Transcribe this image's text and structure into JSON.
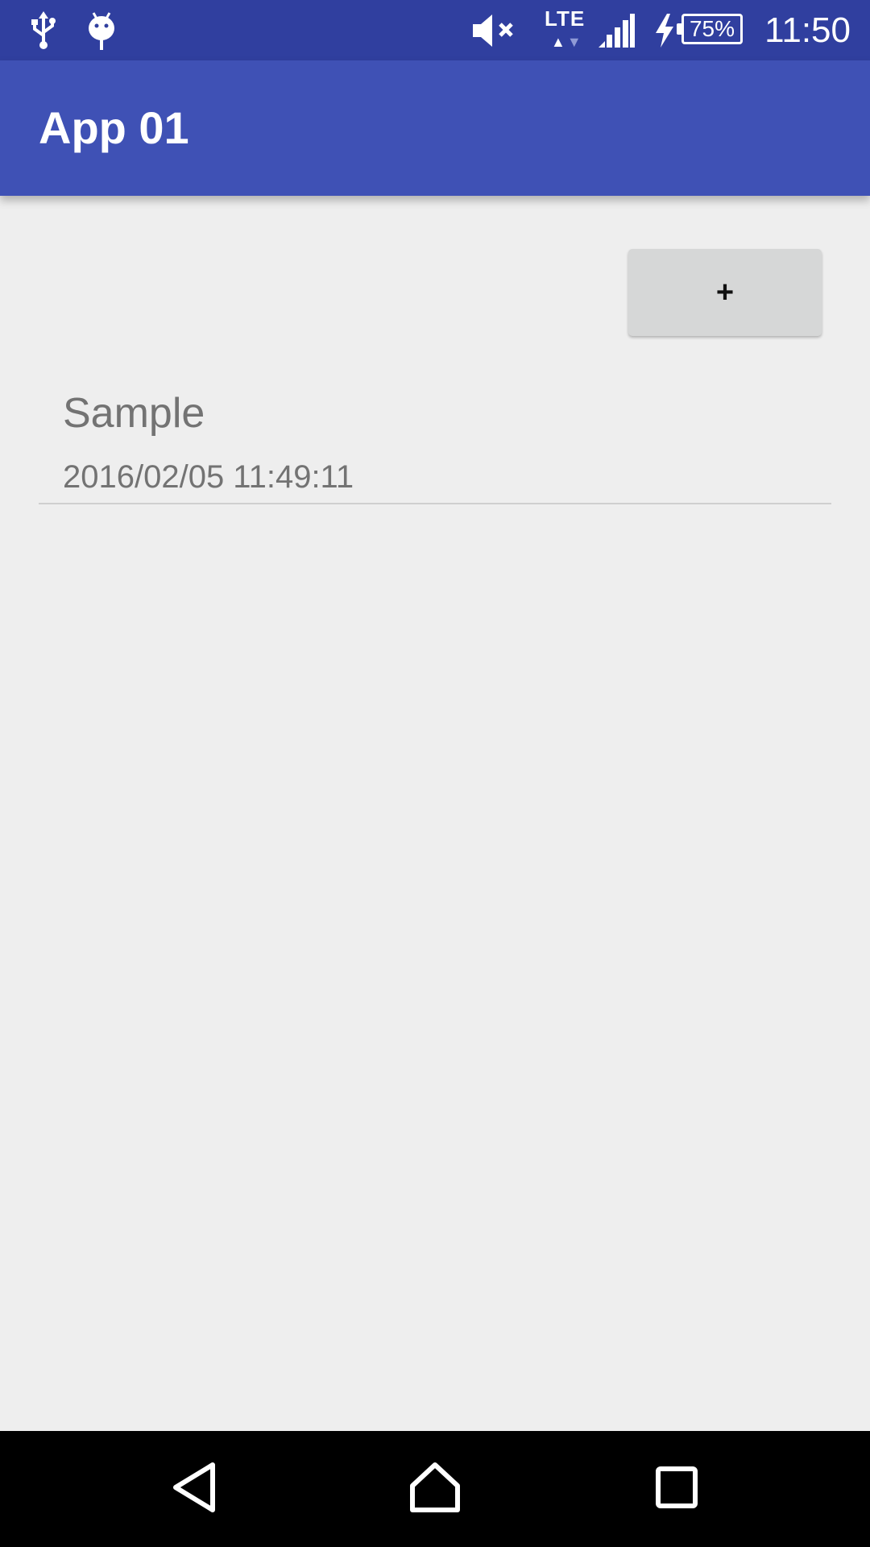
{
  "status_bar": {
    "time": "11:50",
    "battery_percent": "75%",
    "network_type": "LTE",
    "icons": [
      "usb-icon",
      "android-debug-icon",
      "mute-icon",
      "lte-icon",
      "signal-icon",
      "charging-icon",
      "battery-icon"
    ]
  },
  "app_bar": {
    "title": "App 01",
    "color": "#3f51b5",
    "status_color": "#303f9f"
  },
  "toolbar": {
    "add_label": "+"
  },
  "list": {
    "items": [
      {
        "title": "Sample",
        "date": "2016/02/05 11:49:11"
      }
    ]
  },
  "nav_bar": {
    "buttons": [
      "back-icon",
      "home-icon",
      "recents-icon"
    ]
  }
}
